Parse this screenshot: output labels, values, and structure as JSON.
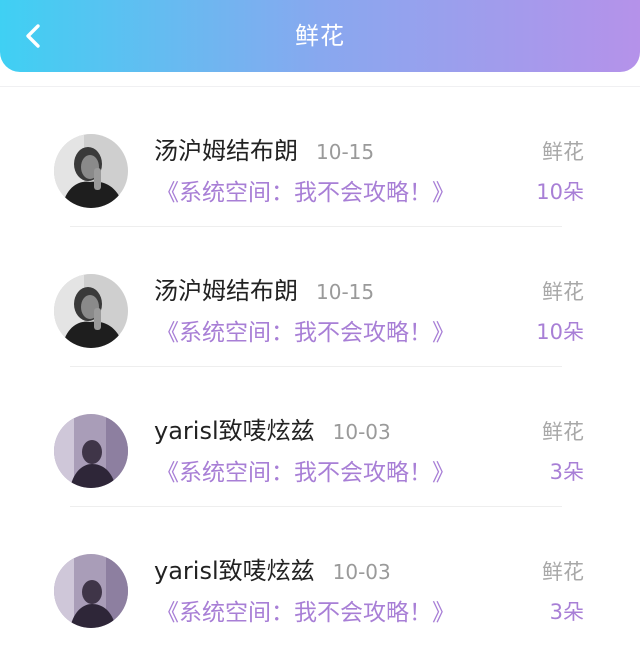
{
  "header": {
    "title": "鲜花",
    "back_icon": "chevron-left-icon"
  },
  "records": [
    {
      "name": "汤沪姆结布朗",
      "date": "10-15",
      "book": "《系统空间：我不会攻略！》",
      "gift": "鲜花",
      "count": "10朵",
      "avatar": "dark"
    },
    {
      "name": "汤沪姆结布朗",
      "date": "10-15",
      "book": "《系统空间：我不会攻略！》",
      "gift": "鲜花",
      "count": "10朵",
      "avatar": "dark"
    },
    {
      "name": "yarisl致唛炫兹",
      "date": "10-03",
      "book": "《系统空间：我不会攻略！》",
      "gift": "鲜花",
      "count": "3朵",
      "avatar": "purple"
    },
    {
      "name": "yarisl致唛炫兹",
      "date": "10-03",
      "book": "《系统空间：我不会攻略！》",
      "gift": "鲜花",
      "count": "3朵",
      "avatar": "purple"
    }
  ],
  "colors": {
    "header_gradient": [
      "#3fd0f3",
      "#88a8ef",
      "#b592ea"
    ],
    "accent": "#a87fd6"
  }
}
